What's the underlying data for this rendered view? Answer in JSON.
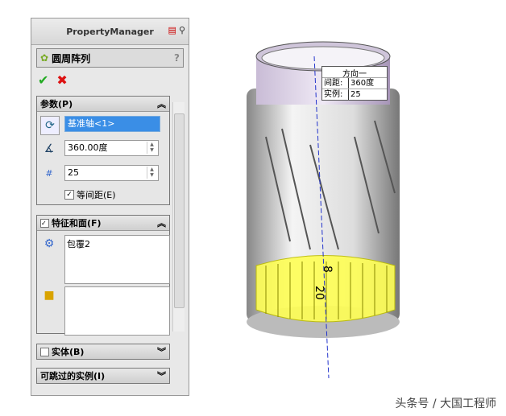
{
  "panel": {
    "title": "PropertyManager",
    "feature": "圆周阵列",
    "help": "?",
    "ok": "✔",
    "cancel": "✖"
  },
  "params": {
    "header": "参数(P)",
    "axis": "基准轴<1>",
    "angle": "360.00度",
    "count": "25",
    "equal_spacing": "等间距(E)"
  },
  "features": {
    "header": "特征和面(F)",
    "item": "包覆2"
  },
  "bodies": {
    "header": "实体(B)"
  },
  "skip": {
    "header": "可跳过的实例(I)"
  },
  "callout": {
    "title": "方向一",
    "spacing_label": "间距:",
    "spacing": "360度",
    "count_label": "实例:",
    "count": "25"
  },
  "dims": {
    "d1": "8",
    "d2": "20"
  },
  "watermark": "头条号 / 大国工程师"
}
